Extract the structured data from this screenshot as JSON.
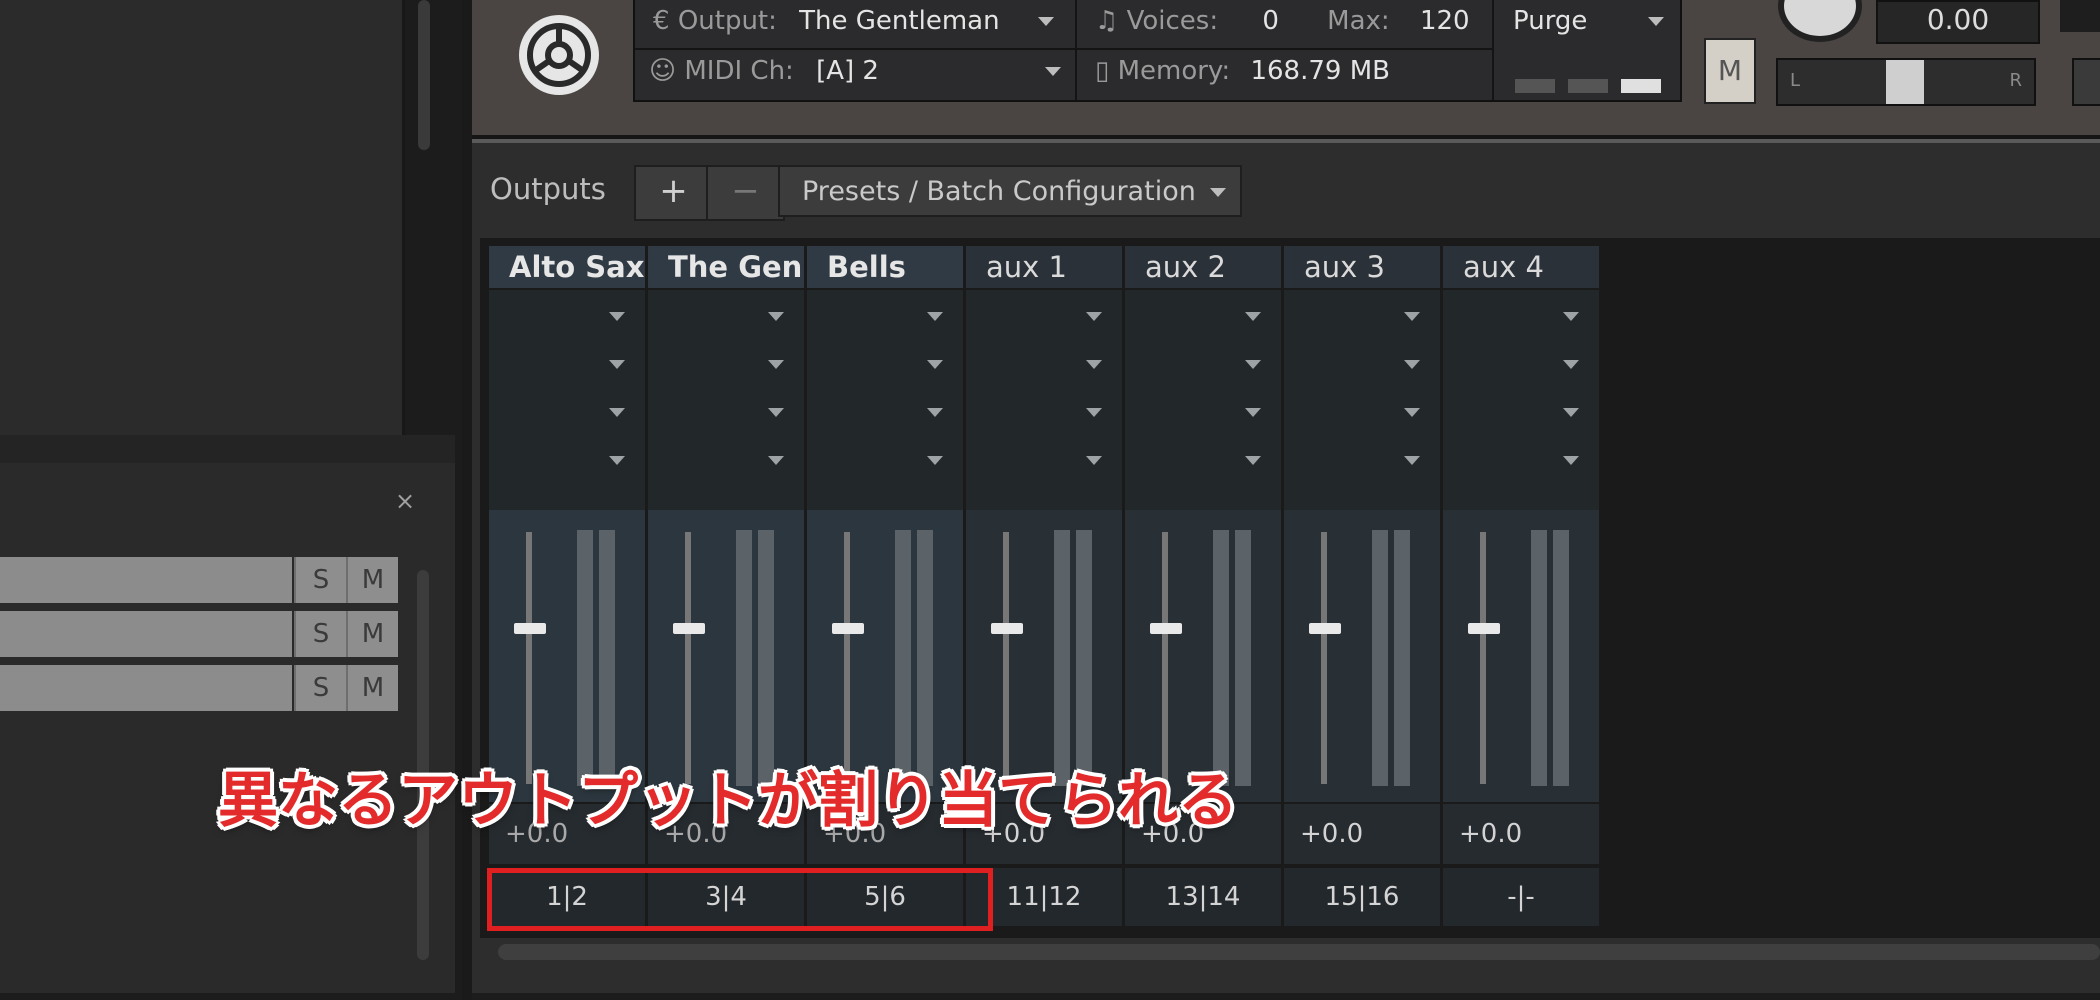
{
  "header": {
    "output_label": "Output:",
    "output_value": "The Gentleman",
    "midi_label": "MIDI Ch:",
    "midi_value": "[A]  2",
    "voices_label": "Voices:",
    "voices_value": "0",
    "max_label": "Max:",
    "max_value": "120",
    "memory_label": "Memory:",
    "memory_value": "168.79 MB",
    "purge_label": "Purge",
    "mute_label": "M",
    "tune_value": "0.00",
    "pan_left": "L",
    "pan_right": "R"
  },
  "outputs": {
    "title": "Outputs",
    "add_label": "+",
    "remove_label": "−",
    "presets_label": "Presets / Batch Configuration",
    "channels": [
      {
        "name": "Alto Sax",
        "db": "+0.0",
        "route": "1|2",
        "fader_level": 0.5
      },
      {
        "name": "The Gen",
        "db": "+0.0",
        "route": "3|4",
        "fader_level": 0.5
      },
      {
        "name": "Bells",
        "db": "+0.0",
        "route": "5|6",
        "fader_level": 0.5
      },
      {
        "name": "aux 1",
        "db": "+0.0",
        "route": "11|12",
        "fader_level": 0.5
      },
      {
        "name": "aux 2",
        "db": "+0.0",
        "route": "13|14",
        "fader_level": 0.5
      },
      {
        "name": "aux 3",
        "db": "+0.0",
        "route": "15|16",
        "fader_level": 0.5
      },
      {
        "name": "aux 4",
        "db": "+0.0",
        "route": "-|-",
        "fader_level": 0.5
      }
    ]
  },
  "left_panel": {
    "close_label": "×",
    "tracks": [
      {
        "solo": "S",
        "mute": "M"
      },
      {
        "solo": "S",
        "mute": "M"
      },
      {
        "solo": "S",
        "mute": "M"
      }
    ]
  },
  "annotation": {
    "text": "異なるアウトプットが割り当てられる",
    "color": "#e32b2b"
  }
}
